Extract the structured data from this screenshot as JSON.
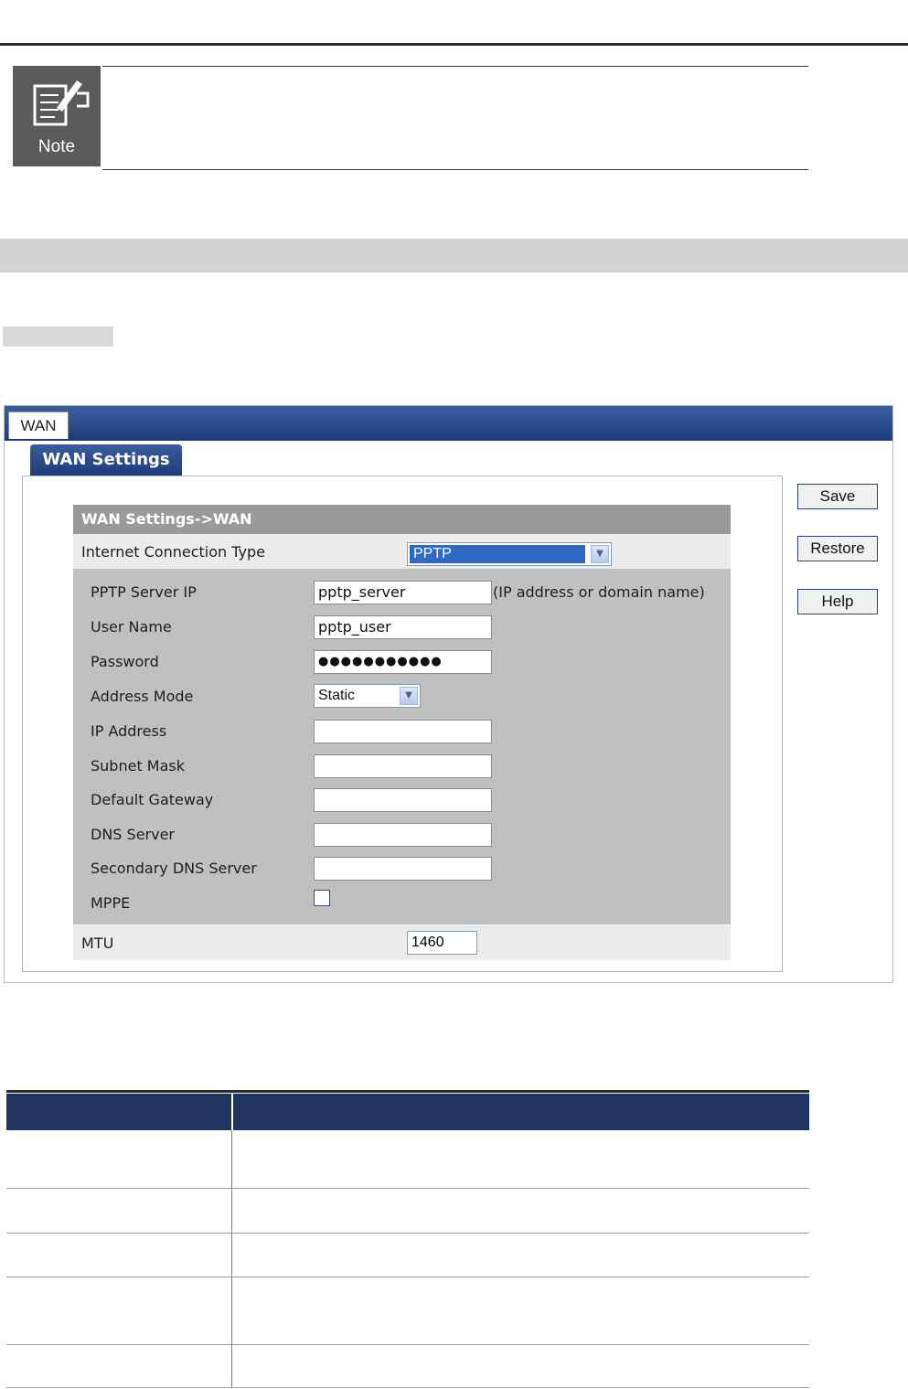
{
  "note": {
    "icon_label": "Note"
  },
  "tabs": {
    "active": "WAN"
  },
  "panel": {
    "title": "WAN Settings"
  },
  "form": {
    "header": "WAN Settings->WAN",
    "connection_type_label": "Internet Connection Type",
    "connection_type_value": "PPTP",
    "fields": {
      "server_ip": {
        "label": "PPTP Server IP",
        "value": "pptp_server",
        "hint": "(IP address or domain name)"
      },
      "user_name": {
        "label": "User Name",
        "value": "pptp_user"
      },
      "password": {
        "label": "Password",
        "value": "●●●●●●●●●●●"
      },
      "address_mode": {
        "label": "Address Mode",
        "value": "Static"
      },
      "ip_address": {
        "label": "IP Address",
        "value": ""
      },
      "subnet_mask": {
        "label": "Subnet Mask",
        "value": ""
      },
      "default_gateway": {
        "label": "Default Gateway",
        "value": ""
      },
      "dns_server": {
        "label": "DNS Server",
        "value": ""
      },
      "secondary_dns": {
        "label": "Secondary DNS Server",
        "value": ""
      },
      "mppe": {
        "label": "MPPE",
        "checked": false
      }
    },
    "mtu": {
      "label": "MTU",
      "value": "1460"
    }
  },
  "buttons": {
    "save": "Save",
    "restore": "Restore",
    "help": "Help"
  },
  "colors": {
    "header_blue": "#1c3b7b",
    "table_header": "#1f3560",
    "form_bg": "#c0c0c0",
    "selected": "#316ac5"
  }
}
